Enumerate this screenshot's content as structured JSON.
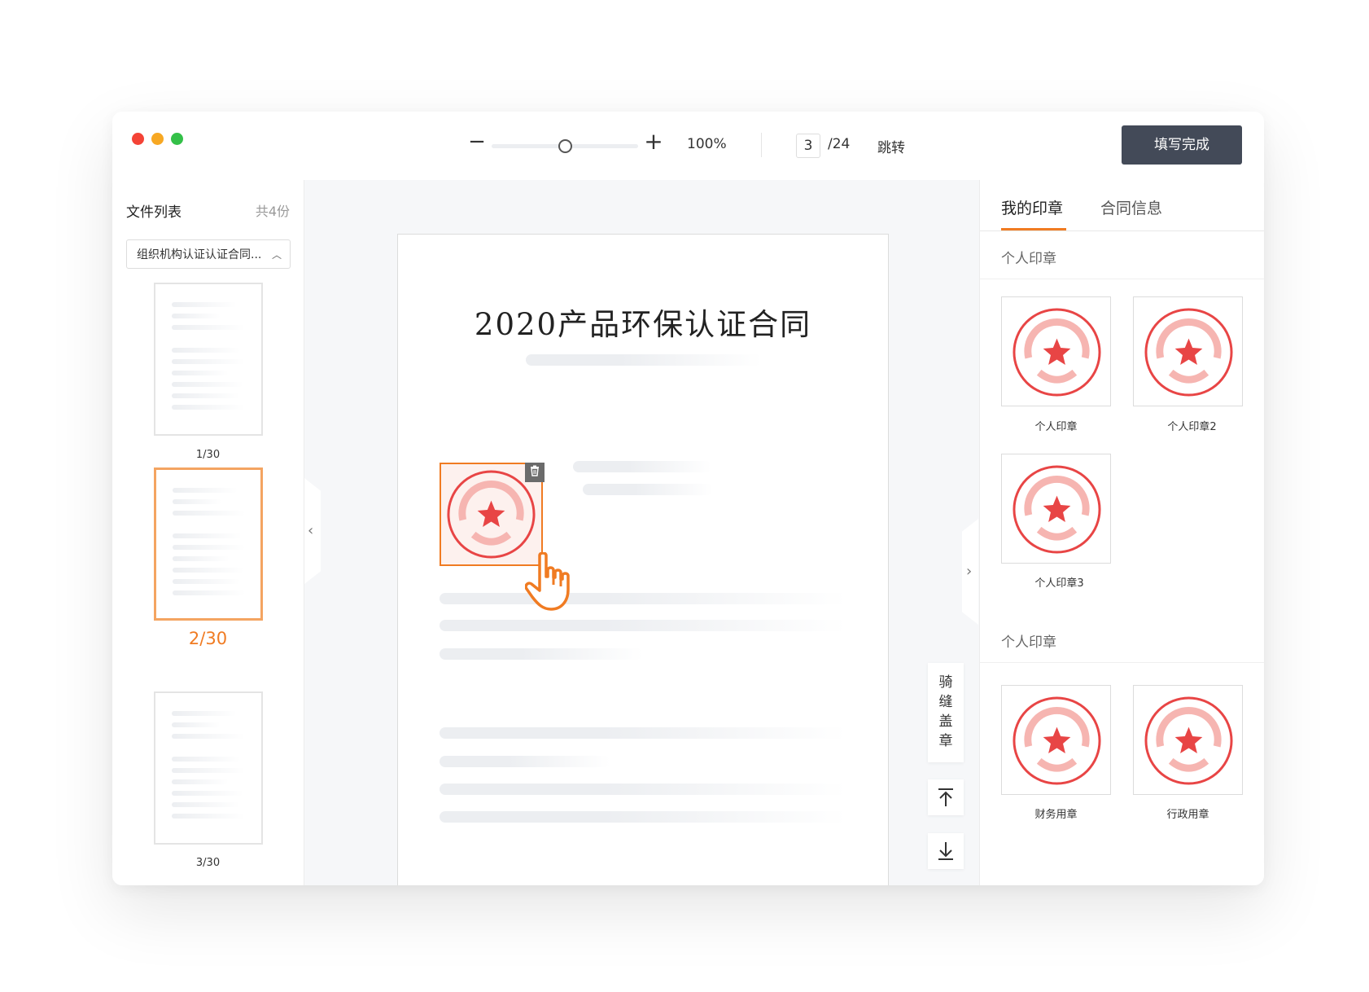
{
  "window": {
    "dots": [
      "#f44336",
      "#f7a823",
      "#34c048"
    ]
  },
  "toolbar": {
    "zoom_minus": "−",
    "zoom_plus": "+",
    "zoom_level": "100%",
    "zoom_slider_value": 0.5,
    "page_current": "3",
    "page_total": "/24",
    "jump_label": "跳转",
    "done_label": "填写完成"
  },
  "file_list": {
    "title": "文件列表",
    "count": "共4份",
    "selected_file": "组织机构认证认证合同...",
    "thumbs": [
      {
        "label": "1/30"
      },
      {
        "label": "2/30"
      },
      {
        "label": "3/30"
      }
    ]
  },
  "document": {
    "title": "2020产品环保认证合同"
  },
  "rail": {
    "qiban": [
      "骑",
      "缝",
      "盖",
      "章"
    ]
  },
  "right_panel": {
    "tabs": [
      "我的印章",
      "合同信息"
    ],
    "personal_title": "个人印章",
    "personal_stamps": [
      "个人印章",
      "个人印章2",
      "个人印章3"
    ],
    "company_title": "个人印章",
    "company_stamps": [
      "财务用章",
      "行政用章"
    ]
  },
  "colors": {
    "accent": "#f07b22",
    "stamp_red": "#e84545",
    "stamp_pink": "#f6b5b1",
    "primary_button": "#434a58"
  },
  "icons": [
    "trash-icon",
    "pointer-hand-icon",
    "chevron-left-icon",
    "chevron-right-icon",
    "to-top-icon",
    "to-bottom-icon",
    "star-icon"
  ]
}
